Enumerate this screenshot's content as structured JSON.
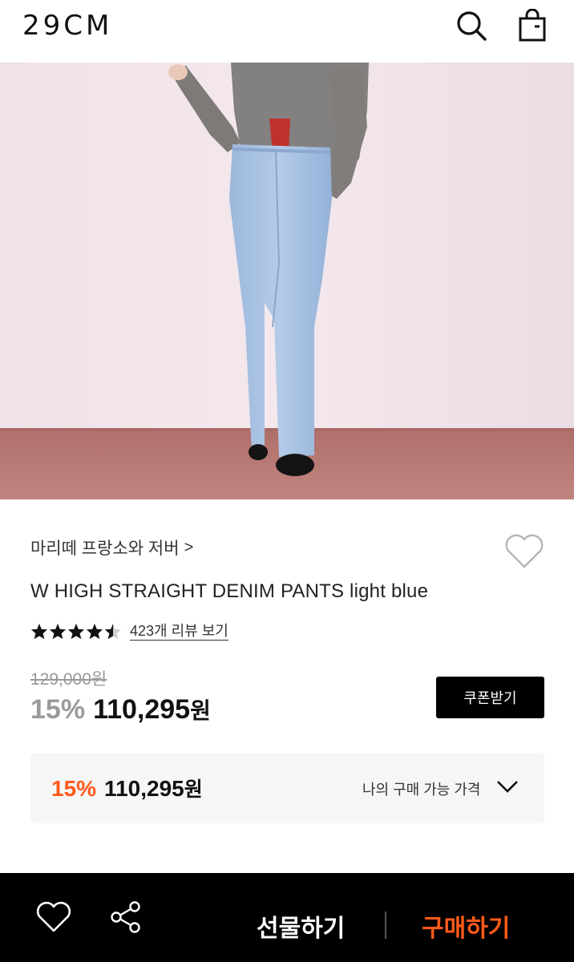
{
  "header": {
    "logo": "29CM",
    "search_icon": "search-icon",
    "bag_icon": "shopping-bag-icon"
  },
  "hero": {
    "image": "product-photo-light-blue-denim"
  },
  "product": {
    "brand": "마리떼 프랑소와 저버",
    "brand_chevron": ">",
    "name": "W HIGH STRAIGHT DENIM PANTS light blue",
    "rating": 4.5,
    "review_link": "423개 리뷰 보기",
    "original_price": "129,000원",
    "discount": "15%",
    "price": "110,295",
    "won": "원",
    "coupon_button": "쿠폰받기"
  },
  "my_price": {
    "discount": "15%",
    "price": "110,295",
    "won": "원",
    "label": "나의 구매 가능 가격"
  },
  "bottom_bar": {
    "gift_button": "선물하기",
    "buy_button": "구매하기"
  },
  "colors": {
    "accent": "#ff5a1a",
    "dark": "#000000",
    "muted": "#999999"
  }
}
